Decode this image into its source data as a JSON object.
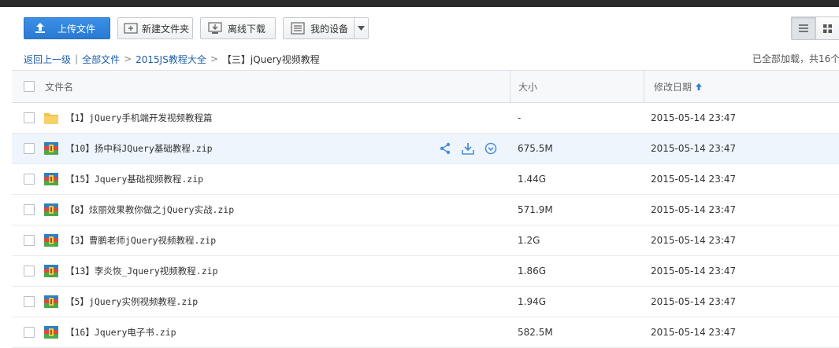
{
  "toolbar": {
    "upload_label": "上传文件",
    "new_folder_label": "新建文件夹",
    "offline_download_label": "离线下载",
    "my_devices_label": "我的设备"
  },
  "breadcrumb": {
    "back": "返回上一级",
    "divider": "|",
    "items": [
      "全部文件",
      "2015JS教程大全"
    ],
    "separator": ">",
    "current": "【三】jQuery视频教程"
  },
  "load_status": "已全部加载，共16个",
  "table": {
    "headers": {
      "name": "文件名",
      "size": "大小",
      "modified": "修改日期"
    },
    "rows": [
      {
        "name": "【1】jQuery手机端开发视频教程篇",
        "size": "-",
        "date": "2015-05-14 23:47",
        "type": "folder"
      },
      {
        "name": "【10】扬中科JQuery基础教程.zip",
        "size": "675.5M",
        "date": "2015-05-14 23:47",
        "type": "zip"
      },
      {
        "name": "【15】Jquery基础视频教程.zip",
        "size": "1.44G",
        "date": "2015-05-14 23:47",
        "type": "zip"
      },
      {
        "name": "【8】炫丽效果教你做之jQuery实战.zip",
        "size": "571.9M",
        "date": "2015-05-14 23:47",
        "type": "zip"
      },
      {
        "name": "【3】曹鹏老师jQuery视频教程.zip",
        "size": "1.2G",
        "date": "2015-05-14 23:47",
        "type": "zip"
      },
      {
        "name": "【13】李炎恢_Jquery视频教程.zip",
        "size": "1.86G",
        "date": "2015-05-14 23:47",
        "type": "zip"
      },
      {
        "name": "【5】jQuery实例视频教程.zip",
        "size": "1.94G",
        "date": "2015-05-14 23:47",
        "type": "zip"
      },
      {
        "name": "【16】Jquery电子书.zip",
        "size": "582.5M",
        "date": "2015-05-14 23:47",
        "type": "zip"
      }
    ]
  },
  "colors": {
    "accent": "#2a7ad2",
    "link": "#1f5fa8",
    "hover_row": "#eef5fd",
    "folder": "#f2c14e"
  },
  "icons": {
    "upload": "upload-icon",
    "new_folder": "folder-plus-icon",
    "offline": "download-box-icon",
    "devices": "device-icon",
    "list_view": "list-view-icon",
    "grid_view": "grid-view-icon",
    "share": "share-icon",
    "download": "download-icon",
    "more": "more-icon",
    "sort": "sort-up-icon"
  }
}
